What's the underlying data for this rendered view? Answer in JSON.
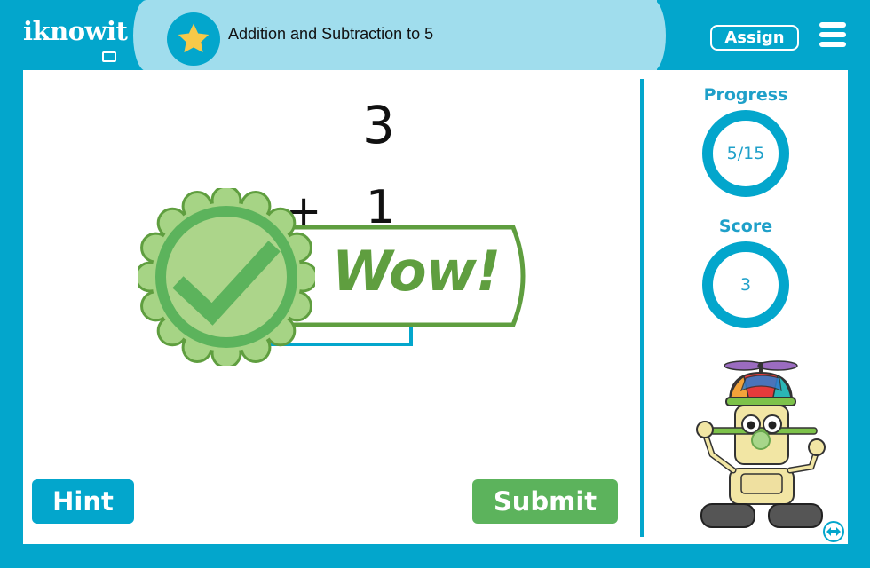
{
  "header": {
    "logo_text": "iknowit",
    "lesson_title": "Addition and Subtraction to 5",
    "assign_label": "Assign",
    "menu_icon": "hamburger-menu-icon",
    "lesson_icon": "star-icon"
  },
  "problem": {
    "top_number": "3",
    "operator": "+",
    "bottom_number": "1",
    "answer_value": "",
    "feedback_text": "Wow!",
    "feedback_icon": "checkmark-icon"
  },
  "buttons": {
    "hint_label": "Hint",
    "submit_label": "Submit"
  },
  "sidebar": {
    "progress_label": "Progress",
    "progress_value": "5/15",
    "progress_fraction": 0.333,
    "score_label": "Score",
    "score_value": "3",
    "mascot": "propeller-hat-robot-mascot",
    "resize_icon": "expand-horizontal-icon"
  },
  "colors": {
    "brand_blue": "#03a6cc",
    "light_blue": "#a0dded",
    "success_green": "#5cb35c",
    "badge_green": "#5f9e3f",
    "star_yellow": "#f7c948"
  }
}
